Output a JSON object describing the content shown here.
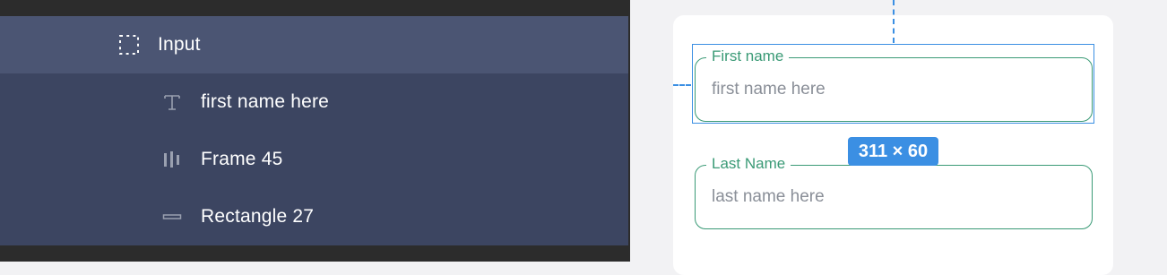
{
  "layers": [
    {
      "name": "Input",
      "icon": "frame-dashed-icon",
      "selected": true
    },
    {
      "name": "first name here",
      "icon": "text-icon",
      "selected": false
    },
    {
      "name": "Frame 45",
      "icon": "auto-layout-icon",
      "selected": false
    },
    {
      "name": "Rectangle 27",
      "icon": "rectangle-icon",
      "selected": false
    }
  ],
  "canvas": {
    "fields": [
      {
        "label": "First name",
        "placeholder": "first name here"
      },
      {
        "label": "Last Name",
        "placeholder": "last name here"
      }
    ],
    "dimension_badge": "311 × 60"
  },
  "colors": {
    "panel_dark": "#2c2c2c",
    "layer_list_bg": "#3c4561",
    "layer_selected_bg": "#4b5573",
    "accent_green": "#3a9a76",
    "selection_blue": "#3b8fe3"
  }
}
